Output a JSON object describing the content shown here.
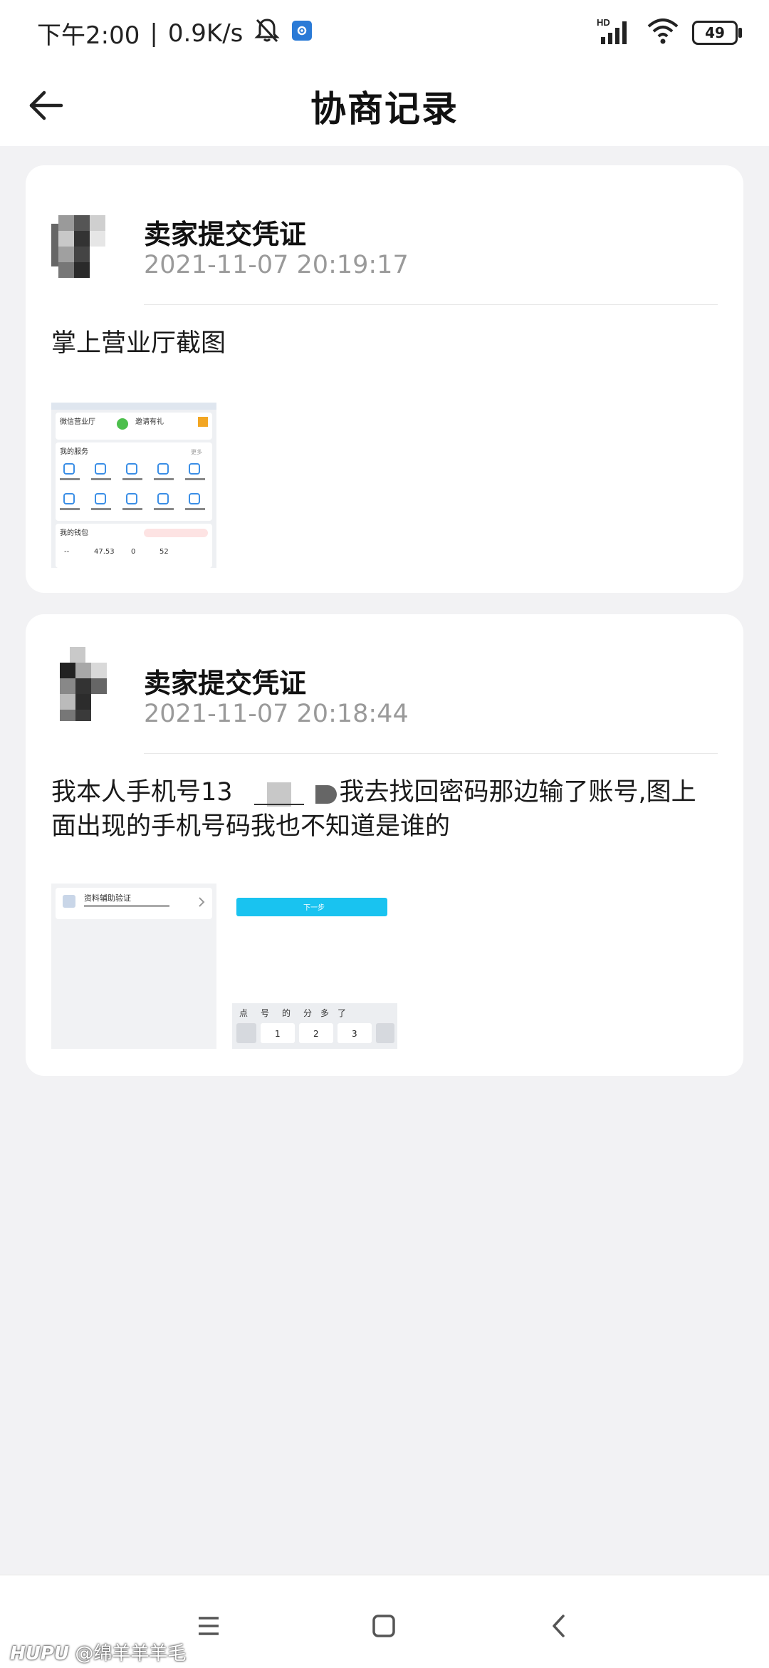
{
  "status_bar": {
    "time": "下午2:00",
    "separator": "|",
    "net_speed": "0.9K/s",
    "hd_label": "HD",
    "battery_level": "49",
    "icons": [
      "mute-bell-icon",
      "app-notification-icon",
      "signal-icon",
      "wifi-icon",
      "battery-icon"
    ]
  },
  "header": {
    "title": "协商记录",
    "back_icon": "arrow-left-icon"
  },
  "records": [
    {
      "title": "卖家提交凭证",
      "time": "2021-11-07 20:19:17",
      "description": "掌上营业厅截图",
      "attachments": 1
    },
    {
      "title": "卖家提交凭证",
      "time": "2021-11-07 20:18:44",
      "description": "我本人手机号13",
      "description_rest": "我去找回密码那边输了账号,图上面出现的手机号码我也不知道是谁的",
      "attachments": 2
    }
  ],
  "thumb1": {
    "label1": "微信营业厅",
    "label2": "邀请有礼",
    "section1": "我的服务",
    "more": "更多",
    "section2": "我的钱包",
    "wallet_values": [
      "--",
      "47.53",
      "0",
      "52"
    ]
  },
  "thumb2": {
    "label": "资料辅助验证",
    "button": "下一步",
    "keys_row1": [
      "点",
      "号",
      "的",
      "分",
      "多",
      "了"
    ],
    "keys_row2": [
      "1",
      "2",
      "3"
    ]
  },
  "navbar": {
    "icons": [
      "menu-icon",
      "home-square-icon",
      "back-chevron-icon"
    ]
  },
  "watermark": {
    "brand": "HUPU",
    "user": "@绵羊羊羊毛"
  },
  "colors": {
    "background": "#f2f2f4",
    "card": "#ffffff",
    "accent_cyan": "#19c3f0",
    "time_gray": "#9a9a9a"
  }
}
